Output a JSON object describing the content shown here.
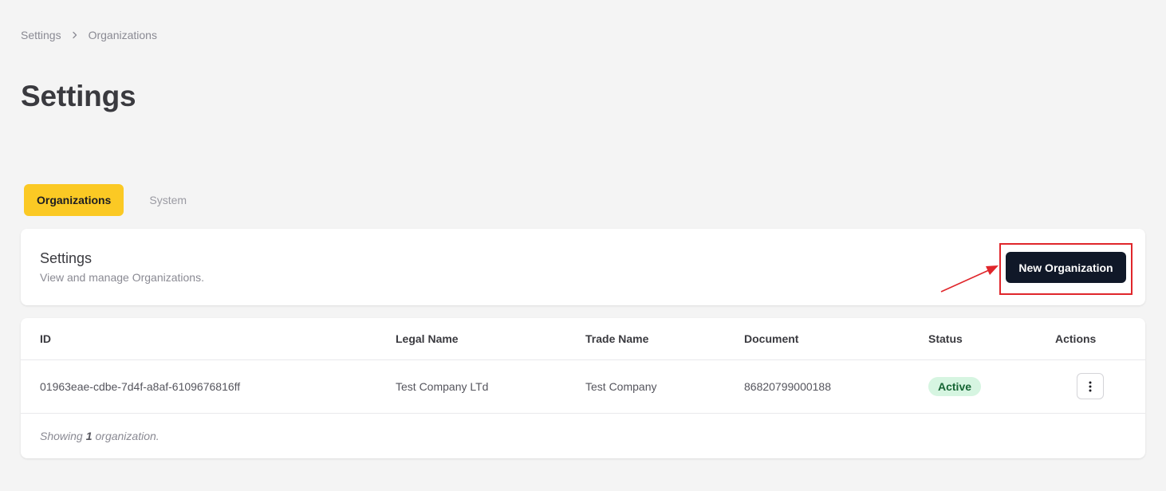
{
  "breadcrumb": {
    "items": [
      "Settings",
      "Organizations"
    ]
  },
  "page": {
    "title": "Settings"
  },
  "tabs": [
    {
      "label": "Organizations",
      "active": true
    },
    {
      "label": "System",
      "active": false
    }
  ],
  "header_card": {
    "title": "Settings",
    "description": "View and manage Organizations.",
    "new_button_label": "New Organization"
  },
  "table": {
    "columns": [
      "ID",
      "Legal Name",
      "Trade Name",
      "Document",
      "Status",
      "Actions"
    ],
    "rows": [
      {
        "id": "01963eae-cdbe-7d4f-a8af-6109676816ff",
        "legal_name": "Test Company LTd",
        "trade_name": "Test Company",
        "document": "86820799000188",
        "status": "Active"
      }
    ],
    "footer": {
      "prefix": "Showing",
      "count": "1",
      "suffix": "organization."
    }
  },
  "colors": {
    "accent_tab": "#fbc924",
    "primary_button": "#101828",
    "status_active_bg": "#d6f5e1",
    "status_active_text": "#166534",
    "annotation": "#e0262b"
  },
  "icons": {
    "breadcrumb_separator": "chevron-right-icon",
    "row_actions": "vertical-ellipsis-icon"
  }
}
